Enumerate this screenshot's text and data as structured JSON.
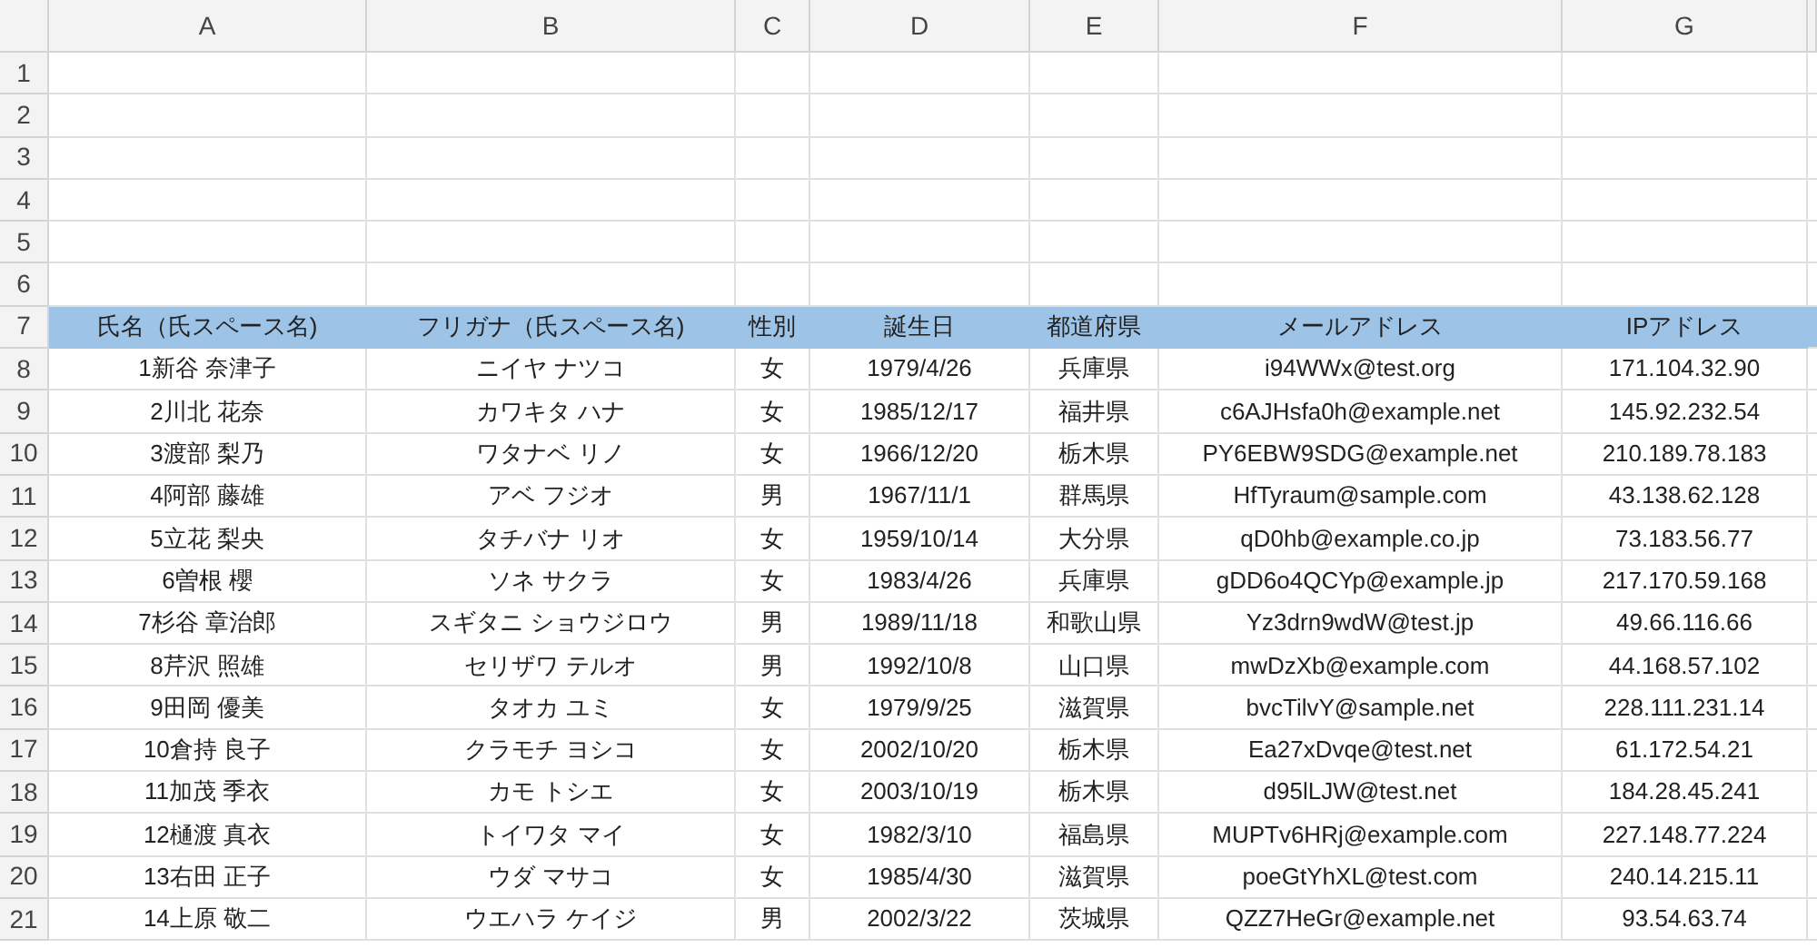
{
  "column_letters": [
    "A",
    "B",
    "C",
    "D",
    "E",
    "F",
    "G"
  ],
  "row_numbers": [
    "1",
    "2",
    "3",
    "4",
    "5",
    "6",
    "7",
    "8",
    "9",
    "10",
    "11",
    "12",
    "13",
    "14",
    "15",
    "16",
    "17",
    "18",
    "19",
    "20",
    "21"
  ],
  "table": {
    "columns": [
      "氏名（氏スペース名)",
      "フリガナ（氏スペース名)",
      "性別",
      "誕生日",
      "都道府県",
      "メールアドレス",
      "IPアドレス"
    ],
    "rows": [
      [
        "1新谷 奈津子",
        "ニイヤ ナツコ",
        "女",
        "1979/4/26",
        "兵庫県",
        "i94WWx@test.org",
        "171.104.32.90"
      ],
      [
        "2川北 花奈",
        "カワキタ ハナ",
        "女",
        "1985/12/17",
        "福井県",
        "c6AJHsfa0h@example.net",
        "145.92.232.54"
      ],
      [
        "3渡部 梨乃",
        "ワタナベ リノ",
        "女",
        "1966/12/20",
        "栃木県",
        "PY6EBW9SDG@example.net",
        "210.189.78.183"
      ],
      [
        "4阿部 藤雄",
        "アベ フジオ",
        "男",
        "1967/11/1",
        "群馬県",
        "HfTyraum@sample.com",
        "43.138.62.128"
      ],
      [
        "5立花 梨央",
        "タチバナ リオ",
        "女",
        "1959/10/14",
        "大分県",
        "qD0hb@example.co.jp",
        "73.183.56.77"
      ],
      [
        "6曽根 櫻",
        "ソネ サクラ",
        "女",
        "1983/4/26",
        "兵庫県",
        "gDD6o4QCYp@example.jp",
        "217.170.59.168"
      ],
      [
        "7杉谷 章治郎",
        "スギタニ ショウジロウ",
        "男",
        "1989/11/18",
        "和歌山県",
        "Yz3drn9wdW@test.jp",
        "49.66.116.66"
      ],
      [
        "8芹沢 照雄",
        "セリザワ テルオ",
        "男",
        "1992/10/8",
        "山口県",
        "mwDzXb@example.com",
        "44.168.57.102"
      ],
      [
        "9田岡 優美",
        "タオカ ユミ",
        "女",
        "1979/9/25",
        "滋賀県",
        "bvcTilvY@sample.net",
        "228.111.231.14"
      ],
      [
        "10倉持 良子",
        "クラモチ ヨシコ",
        "女",
        "2002/10/20",
        "栃木県",
        "Ea27xDvqe@test.net",
        "61.172.54.21"
      ],
      [
        "11加茂 季衣",
        "カモ トシエ",
        "女",
        "2003/10/19",
        "栃木県",
        "d95lLJW@test.net",
        "184.28.45.241"
      ],
      [
        "12樋渡 真衣",
        "トイワタ マイ",
        "女",
        "1982/3/10",
        "福島県",
        "MUPTv6HRj@example.com",
        "227.148.77.224"
      ],
      [
        "13右田 正子",
        "ウダ マサコ",
        "女",
        "1985/4/30",
        "滋賀県",
        "poeGtYhXL@test.com",
        "240.14.215.11"
      ],
      [
        "14上原 敬二",
        "ウエハラ ケイジ",
        "男",
        "2002/3/22",
        "茨城県",
        "QZZ7HeGr@example.net",
        "93.54.63.74"
      ]
    ]
  }
}
